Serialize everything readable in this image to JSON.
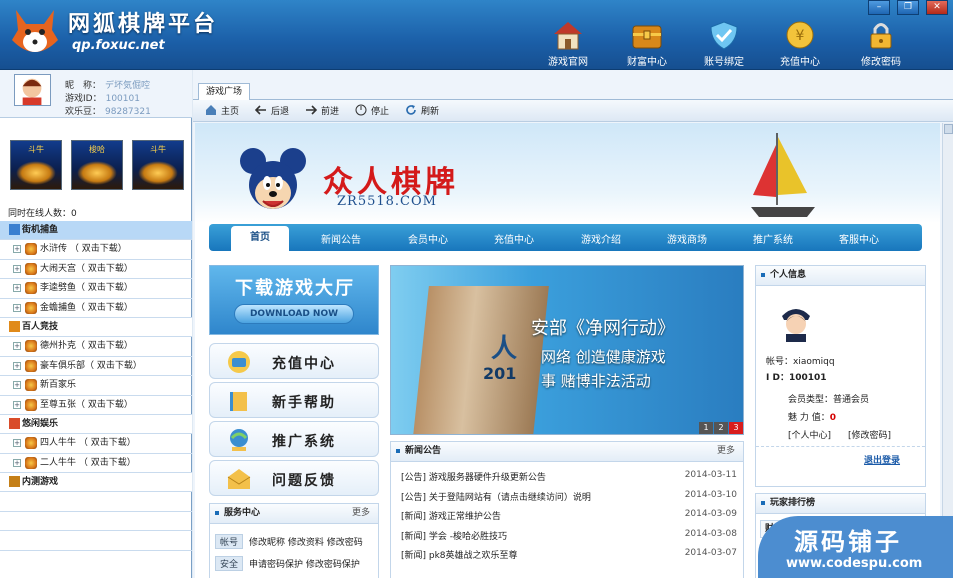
{
  "app": {
    "title": "网狐棋牌平台",
    "url": "qp.foxuc.net"
  },
  "window_controls": [
    "minimize-icon",
    "restore-icon",
    "close-icon"
  ],
  "toolbar": [
    {
      "label": "游戏官网",
      "icon": "house-icon"
    },
    {
      "label": "财富中心",
      "icon": "treasure-chest-icon"
    },
    {
      "label": "账号绑定",
      "icon": "shield-icon"
    },
    {
      "label": "充值中心",
      "icon": "coin-icon"
    },
    {
      "label": "修改密码",
      "icon": "lock-icon"
    }
  ],
  "user": {
    "nickname_label": "昵　称：",
    "nickname": "デ坏気倔啌",
    "gameid_label": "游戏ID：",
    "gameid": "100101",
    "beans_label": "欢乐豆：",
    "beans": "98287321"
  },
  "left_games": [
    "斗牛",
    "梭哈",
    "斗牛"
  ],
  "online_label": "同时在线人数：0",
  "tree": [
    {
      "type": "category",
      "label": "街机捕鱼",
      "selected": true
    },
    {
      "type": "item",
      "label": "水浒传 （ 双击下载）"
    },
    {
      "type": "item",
      "label": "大闹天宫（ 双击下载）"
    },
    {
      "type": "item",
      "label": "李逵劈鱼（ 双击下载）"
    },
    {
      "type": "item",
      "label": "金蟾捕鱼（ 双击下载）"
    },
    {
      "type": "category",
      "label": "百人竞技"
    },
    {
      "type": "item",
      "label": "德州扑克（ 双击下载）"
    },
    {
      "type": "item",
      "label": "豪车俱乐部（ 双击下载）"
    },
    {
      "type": "item",
      "label": "新百家乐"
    },
    {
      "type": "item",
      "label": "至尊五张（ 双击下载）"
    },
    {
      "type": "category",
      "label": "悠闲娱乐"
    },
    {
      "type": "item",
      "label": "四人牛牛 （ 双击下载）"
    },
    {
      "type": "item",
      "label": "二人牛牛 （ 双击下载）"
    },
    {
      "type": "category",
      "label": "内测游戏"
    },
    {
      "type": "blank",
      "label": ""
    },
    {
      "type": "blank",
      "label": ""
    },
    {
      "type": "blank",
      "label": ""
    }
  ],
  "tab": {
    "label": "游戏广场"
  },
  "browser_nav": [
    "主页",
    "后退",
    "前进",
    "停止",
    "刷新"
  ],
  "site": {
    "title": "众人棋牌",
    "url": "ZR5518.COM",
    "nav": [
      "首页",
      "新闻公告",
      "会员中心",
      "充值中心",
      "游戏介绍",
      "游戏商场",
      "推广系统",
      "客服中心"
    ],
    "download_title": "下载游戏大厅",
    "download_btn": "DOWNLOAD NOW",
    "side_links": [
      "充值中心",
      "新手帮助",
      "推广系统",
      "问题反馈"
    ],
    "service": {
      "title": "服务中心",
      "more": "更多",
      "row1_tag": "帐号",
      "row1_text": "修改昵称  修改资料  修改密码",
      "row2_tag": "安全",
      "row2_text": "申请密码保护  修改密码保护"
    },
    "slide": {
      "t1": "安部《净网行动》",
      "big": "人",
      "t2": "网络  创造健康游戏",
      "yr": "201",
      "t3": "事  赌博非法活动",
      "dots": [
        "1",
        "2",
        "3"
      ]
    },
    "news": {
      "title": "新闻公告",
      "more": "更多",
      "items": [
        {
          "title": "[公告] 游戏服务器硬件升级更新公告",
          "date": "2014-03-11"
        },
        {
          "title": "[公告] 关于登陆网站有（请点击继续访问）说明",
          "date": "2014-03-10"
        },
        {
          "title": "[新闻] 游戏正常维护公告",
          "date": "2014-03-09"
        },
        {
          "title": "[新闻] 学会 -梭哈必胜技巧",
          "date": "2014-03-08"
        },
        {
          "title": "[新闻] pk8英雄战之欢乐至尊",
          "date": "2014-03-07"
        }
      ]
    },
    "profile": {
      "title": "个人信息",
      "account": "帐号：xiaomiqq",
      "id": "I D：100101",
      "member": "会员类型：普通会员",
      "charm_label": "魅 力 值：",
      "charm": "0",
      "link1": "[个人中心]",
      "link2": "[修改密码]",
      "logout": "退出登录"
    },
    "rank": {
      "title": "玩家排行榜",
      "tab": "财富排行"
    }
  },
  "watermark": {
    "text": "源码铺子",
    "url": "www.codespu.com"
  }
}
